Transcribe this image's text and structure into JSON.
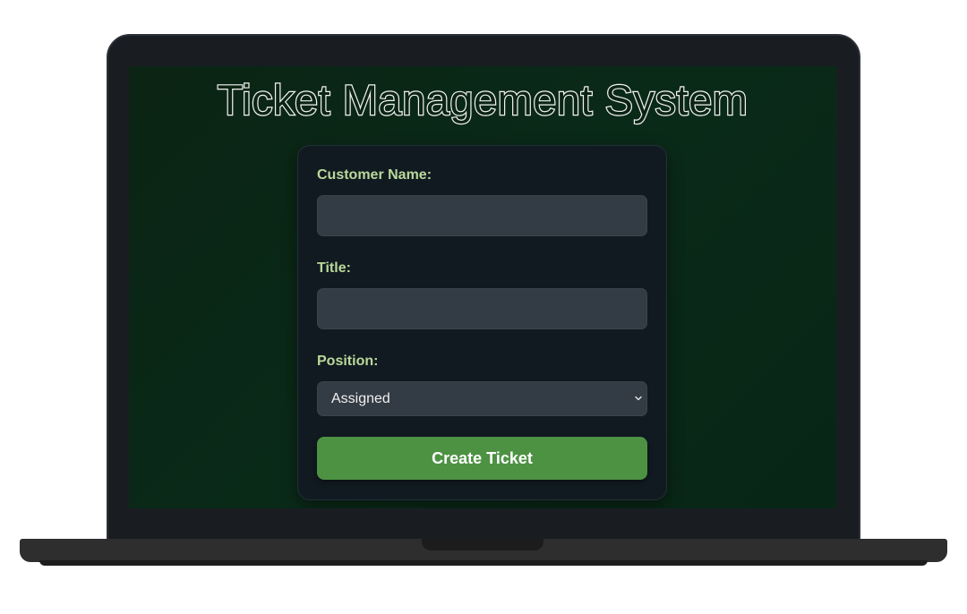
{
  "app": {
    "title": "Ticket Management System"
  },
  "form": {
    "customer_name": {
      "label": "Customer Name:",
      "value": "",
      "placeholder": ""
    },
    "title": {
      "label": "Title:",
      "value": "",
      "placeholder": ""
    },
    "position": {
      "label": "Position:",
      "selected": "Assigned",
      "icon": "chevron-down-icon"
    },
    "submit_label": "Create Ticket"
  },
  "colors": {
    "background": "#0b2414",
    "card": "#111a21",
    "label": "#b9d99a",
    "input": "#333b44",
    "button": "#4d9243",
    "bezel": "#191d22"
  }
}
